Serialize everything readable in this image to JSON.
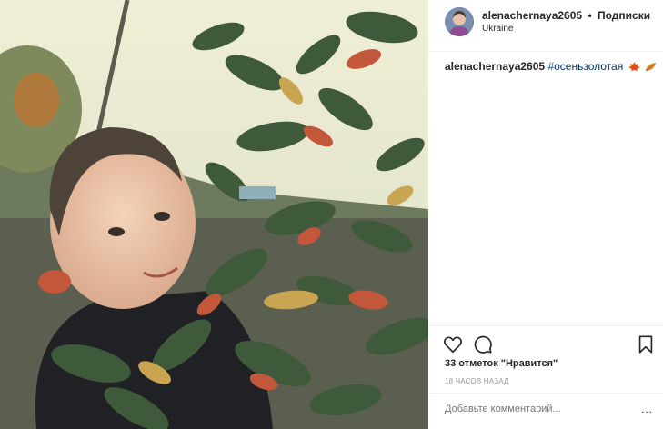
{
  "header": {
    "username": "alenachernaya2605",
    "separator": "•",
    "follow_label": "Подписки",
    "location": "Ukraine"
  },
  "caption": {
    "username": "alenachernaya2605",
    "hashtag": "#осеньзолотая",
    "emojis": [
      "maple-leaf-icon",
      "fallen-leaf-icon"
    ]
  },
  "actions": {
    "icons": [
      "heart-icon",
      "comment-icon",
      "bookmark-icon"
    ]
  },
  "likes_text": "33 отметок \"Нравится\"",
  "timestamp": "18 ЧАСОВ НАЗАД",
  "comment": {
    "placeholder": "Добавьте комментарий...",
    "more_label": "..."
  },
  "colors": {
    "hashtag": "#003569",
    "muted": "#999999",
    "divider": "#efefef"
  }
}
